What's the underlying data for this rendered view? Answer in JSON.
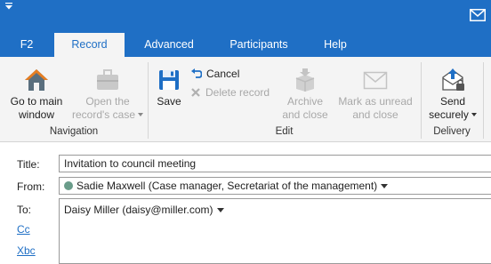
{
  "tabs": [
    "F2",
    "Record",
    "Advanced",
    "Participants",
    "Help"
  ],
  "active_tab": "Record",
  "ribbon": {
    "goto_main": [
      "Go to main",
      "window"
    ],
    "open_case": [
      "Open the",
      "record's case"
    ],
    "save": "Save",
    "cancel": "Cancel",
    "delete_record": "Delete record",
    "archive": [
      "Archive",
      "and close"
    ],
    "mark_unread": [
      "Mark as unread",
      "and close"
    ],
    "send_securely": [
      "Send",
      "securely"
    ],
    "groups": {
      "navigation": "Navigation",
      "edit": "Edit",
      "delivery": "Delivery"
    }
  },
  "form": {
    "title_label": "Title:",
    "title_value": "Invitation to council meeting",
    "from_label": "From:",
    "from_value": "Sadie Maxwell (Case manager, Secretariat of the management)",
    "to_label": "To:",
    "to_value": "Daisy Miller (daisy@miller.com)",
    "cc_label": "Cc",
    "bcc_label": "Xbc"
  },
  "colors": {
    "accent": "#1f6fc5",
    "ribbon_bg": "#f4f4f4",
    "disabled": "#a8a8a8"
  },
  "icons": [
    "quick-access-icon",
    "mail-icon",
    "home-icon",
    "briefcase-icon",
    "save-icon",
    "undo-icon",
    "delete-icon",
    "archive-icon",
    "envelope-icon",
    "secure-send-icon"
  ]
}
